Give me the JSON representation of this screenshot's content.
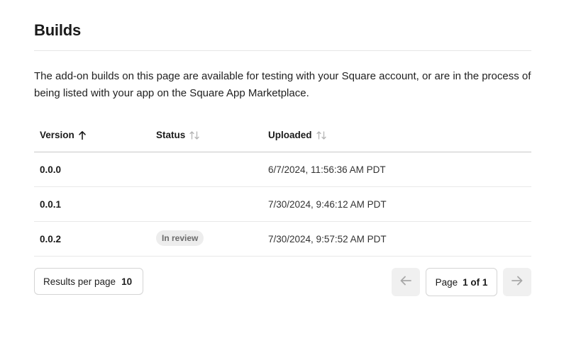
{
  "page": {
    "title": "Builds",
    "description": "The add-on builds on this page are available for testing with your Square account, or are in the process of being listed with your app on the Square App Marketplace."
  },
  "table": {
    "columns": [
      {
        "label": "Version",
        "sort": "ascending"
      },
      {
        "label": "Status",
        "sort": "none"
      },
      {
        "label": "Uploaded",
        "sort": "none"
      }
    ],
    "rows": [
      {
        "version": "0.0.0",
        "status": "",
        "uploaded": "6/7/2024, 11:56:36 AM PDT"
      },
      {
        "version": "0.0.1",
        "status": "",
        "uploaded": "7/30/2024, 9:46:12 AM PDT"
      },
      {
        "version": "0.0.2",
        "status": "In review",
        "uploaded": "7/30/2024, 9:57:52 AM PDT"
      }
    ]
  },
  "pagination": {
    "results_label": "Results per page",
    "results_value": "10",
    "page_label": "Page",
    "page_value": "1 of 1",
    "prev_icon": "arrow-left-icon",
    "next_icon": "arrow-right-icon"
  },
  "colors": {
    "text": "#1a1a1a",
    "divider": "#e6e6e6",
    "badge_bg": "#ededed",
    "badge_text": "#6b6b6b",
    "disabled_button_bg": "#f0f0f0"
  }
}
